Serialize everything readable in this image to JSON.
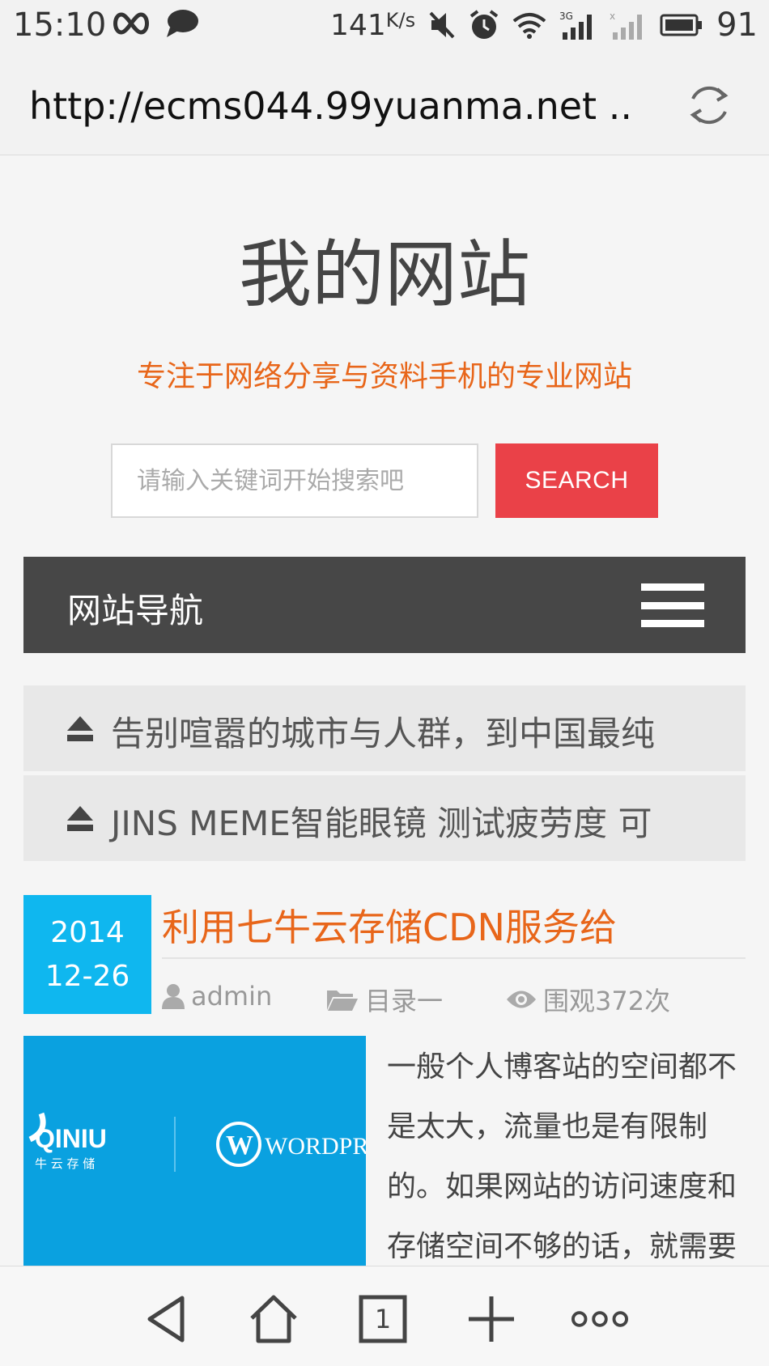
{
  "status_bar": {
    "time": "15:10",
    "speed": "141",
    "speed_unit": "K/s",
    "battery": "91"
  },
  "browser": {
    "url": "http://ecms044.99yuanma.net ..",
    "tabs_count": "1"
  },
  "site": {
    "title": "我的网站",
    "subtitle": "专注于网络分享与资料手机的专业网站"
  },
  "search": {
    "placeholder": "请输入关键词开始搜索吧",
    "button_label": "SEARCH"
  },
  "nav": {
    "label": "网站导航"
  },
  "notices": [
    {
      "text": "告别喧嚣的城市与人群，到中国最纯"
    },
    {
      "text": "JINS MEME智能眼镜 测试疲劳度 可"
    }
  ],
  "post": {
    "date_year": "2014",
    "date_md": "12-26",
    "title": "利用七牛云存储CDN服务给",
    "author": "admin",
    "category": "目录一",
    "views": "围观372次",
    "excerpt": "一般个人博客站的空间都不是太大，流量也是有限制的。如果网站的访问速度和存储空间不够的话，就需要",
    "thumb_logo_left": "QINIU",
    "thumb_logo_left_sub": "牛 云 存 储",
    "thumb_logo_right": "WORDPR"
  },
  "colors": {
    "accent_orange": "#e8661a",
    "search_red": "#ea4148",
    "nav_dark": "#474747",
    "date_blue": "#0fb7ef"
  }
}
